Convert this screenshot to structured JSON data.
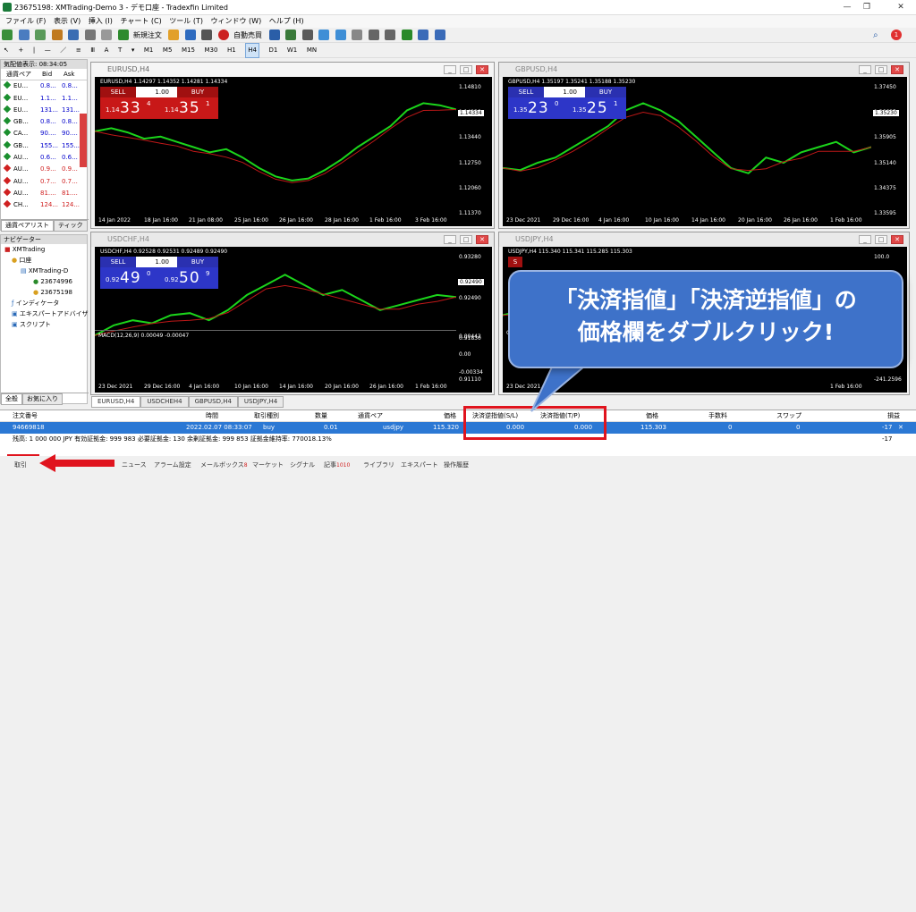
{
  "window": {
    "title": "23675198: XMTrading-Demo 3 - デモ口座 - Tradexfin Limited"
  },
  "menu": [
    "ファイル (F)",
    "表示 (V)",
    "挿入 (I)",
    "チャート (C)",
    "ツール (T)",
    "ウィンドウ (W)",
    "ヘルプ (H)"
  ],
  "toolbar": {
    "new_order": "新規注文",
    "auto_trading": "自動売買"
  },
  "timeframes": [
    "M1",
    "M5",
    "M15",
    "M30",
    "H1",
    "H4",
    "D1",
    "W1",
    "MN"
  ],
  "timeframe_selected": "H4",
  "notifications": "1",
  "market_watch": {
    "header": "気配値表示: 08:34:05",
    "columns": [
      "通貨ペア",
      "Bid",
      "Ask"
    ],
    "rows": [
      {
        "sym": "EU...",
        "bid": "0.8...",
        "ask": "0.8...",
        "color": "#1a8f2e",
        "bc": "#0000cc"
      },
      {
        "sym": "EU...",
        "bid": "1.1...",
        "ask": "1.1...",
        "color": "#1a8f2e",
        "bc": "#0000cc"
      },
      {
        "sym": "EU...",
        "bid": "131...",
        "ask": "131...",
        "color": "#1a8f2e",
        "bc": "#0000cc"
      },
      {
        "sym": "GB...",
        "bid": "0.8...",
        "ask": "0.8...",
        "color": "#1a8f2e",
        "bc": "#0000cc"
      },
      {
        "sym": "CA...",
        "bid": "90....",
        "ask": "90....",
        "color": "#1a8f2e",
        "bc": "#0000cc"
      },
      {
        "sym": "GB...",
        "bid": "155...",
        "ask": "155...",
        "color": "#1a8f2e",
        "bc": "#0000cc"
      },
      {
        "sym": "AU...",
        "bid": "0.6...",
        "ask": "0.6...",
        "color": "#1a8f2e",
        "bc": "#0000cc"
      },
      {
        "sym": "AU...",
        "bid": "0.9...",
        "ask": "0.9...",
        "color": "#d02020",
        "bc": "#d02020"
      },
      {
        "sym": "AU...",
        "bid": "0.7...",
        "ask": "0.7...",
        "color": "#d02020",
        "bc": "#d02020"
      },
      {
        "sym": "AU...",
        "bid": "81....",
        "ask": "81....",
        "color": "#d02020",
        "bc": "#d02020"
      },
      {
        "sym": "CH...",
        "bid": "124...",
        "ask": "124...",
        "color": "#d02020",
        "bc": "#d02020"
      }
    ],
    "tabs": [
      "通貨ペアリスト",
      "ティック"
    ]
  },
  "navigator": {
    "header": "ナビゲーター",
    "items": [
      "XMTrading",
      "口座",
      "XMTrading-D",
      "23674996",
      "23675198",
      "インディケータ",
      "エキスパートアドバイザ",
      "スクリプト"
    ],
    "tabs": [
      "全般",
      "お気に入り"
    ]
  },
  "charts": [
    {
      "title": "EURUSD,H4",
      "info": "EURUSD,H4  1.14297 1.14352 1.14281 1.14334",
      "sell_small": "1.14",
      "sell_big": "33",
      "sell_sup": "4",
      "buy_small": "1.14",
      "buy_big": "35",
      "buy_sup": "1",
      "lot": "1.00",
      "sell": "SELL",
      "buy": "BUY",
      "price_box": "1.14334",
      "yticks": [
        "1.14810",
        "1.14120",
        "1.13440",
        "1.12750",
        "1.12060",
        "1.11370"
      ],
      "xticks": [
        "14 Jan 2022",
        "18 Jan 16:00",
        "21 Jan 08:00",
        "25 Jan 16:00",
        "26 Jan 16:00",
        "28 Jan 16:00",
        "1 Feb 16:00",
        "3 Feb 16:00"
      ],
      "theme": "red",
      "active": true
    },
    {
      "title": "GBPUSD,H4",
      "info": "GBPUSD,H4  1.35197 1.35241 1.35188 1.35230",
      "sell_small": "1.35",
      "sell_big": "23",
      "sell_sup": "0",
      "buy_small": "1.35",
      "buy_big": "25",
      "buy_sup": "1",
      "lot": "1.00",
      "sell": "SELL",
      "buy": "BUY",
      "price_box": "1.35230",
      "yticks": [
        "1.37450",
        "1.36685",
        "1.35905",
        "1.35140",
        "1.34375",
        "1.33595"
      ],
      "xticks": [
        "23 Dec 2021",
        "29 Dec 16:00",
        "4 Jan 16:00",
        "10 Jan 16:00",
        "14 Jan 16:00",
        "20 Jan 16:00",
        "26 Jan 16:00",
        "1 Feb 16:00"
      ],
      "theme": "blue",
      "active": false
    },
    {
      "title": "USDCHF,H4",
      "info": "USDCHF,H4  0.92528 0.92531 0.92489 0.92490",
      "sell_small": "0.92",
      "sell_big": "49",
      "sell_sup": "0",
      "buy_small": "0.92",
      "buy_big": "50",
      "buy_sup": "9",
      "lot": "1.00",
      "sell": "SELL",
      "buy": "BUY",
      "price_box": "0.92490",
      "yticks": [
        "0.93280",
        "0.92490",
        "0.91830",
        "0.91110"
      ],
      "macd_label": "MACD(12,26,9) 0.00049 -0.00047",
      "macd_ticks": [
        "0.00442",
        "0.00",
        "-0.00334"
      ],
      "xticks": [
        "23 Dec 2021",
        "29 Dec 16:00",
        "4 Jan 16:00",
        "10 Jan 16:00",
        "14 Jan 16:00",
        "20 Jan 16:00",
        "26 Jan 16:00",
        "1 Feb 16:00"
      ],
      "theme": "blue",
      "active": false
    },
    {
      "title": "USDJPY,H4",
      "info": "USDJPY,H4  115.340 115.341 115.285 115.303",
      "sell_small": "",
      "sell_big": "",
      "sell_sup": "",
      "buy_small": "",
      "buy_big": "",
      "buy_sup": "",
      "lot": "",
      "sell": "S",
      "buy": "",
      "price_box": "",
      "yticks": [
        "100.0",
        "0.0",
        "-241.2596"
      ],
      "cci_label": "CCI(",
      "xticks": [
        "23 Dec 2021",
        "1 Feb 16:00"
      ],
      "theme": "red",
      "active": false
    }
  ],
  "chart_tabs": [
    "EURUSD,H4",
    "USDCHEH4",
    "GBPUSD,H4",
    "USDJPY,H4"
  ],
  "callout": {
    "line1": "「決済指値」「決済逆指値」の",
    "line2": "価格欄をダブルクリック!"
  },
  "terminal": {
    "headers": [
      "注文番号",
      "時間",
      "取引種別",
      "数量",
      "通貨ペア",
      "価格",
      "決済逆指値(S/L)",
      "決済指値(T/P)",
      "価格",
      "手数料",
      "スワップ",
      "損益"
    ],
    "row": {
      "ticket": "94669818",
      "time": "2022.02.07 08:33:07",
      "type": "buy",
      "volume": "0.01",
      "symbol": "usdjpy",
      "price": "115.320",
      "sl": "0.000",
      "tp": "0.000",
      "cur_price": "115.303",
      "commission": "0",
      "swap": "0",
      "profit": "-17"
    },
    "balance": "残高: 1 000 000 JPY  有効証拠金: 999 983  必要証拠金: 130  余剰証拠金: 999 853  証拠金維持率: 770018.13%",
    "balance_profit": "-17"
  },
  "bottom_tabs": [
    "取引",
    "ニュース",
    "アラーム設定",
    "メールボックス",
    "マーケット",
    "シグナル",
    "記事",
    "ライブラリ",
    "エキスパート",
    "操作履歴"
  ],
  "bottom_badges": {
    "mail": "8",
    "articles": "1010"
  },
  "terminal_side_label": "ターミナル"
}
